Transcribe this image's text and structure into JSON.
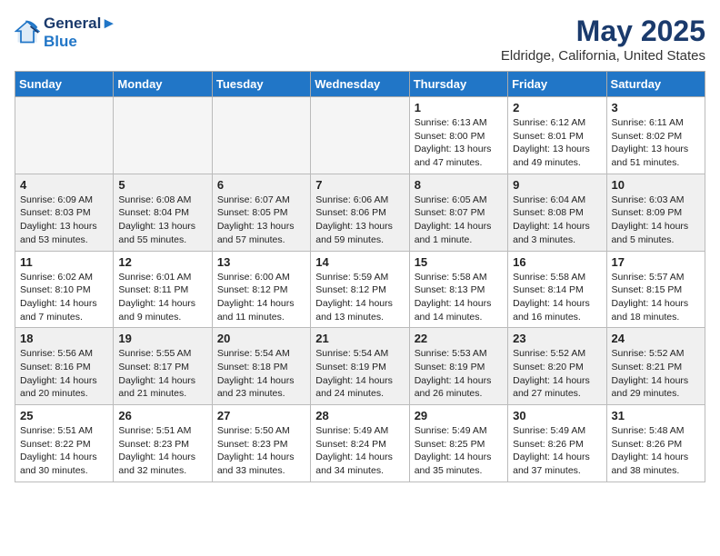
{
  "logo": {
    "line1": "General",
    "line2": "Blue"
  },
  "title": "May 2025",
  "location": "Eldridge, California, United States",
  "weekdays": [
    "Sunday",
    "Monday",
    "Tuesday",
    "Wednesday",
    "Thursday",
    "Friday",
    "Saturday"
  ],
  "weeks": [
    [
      {
        "day": "",
        "info": ""
      },
      {
        "day": "",
        "info": ""
      },
      {
        "day": "",
        "info": ""
      },
      {
        "day": "",
        "info": ""
      },
      {
        "day": "1",
        "info": "Sunrise: 6:13 AM\nSunset: 8:00 PM\nDaylight: 13 hours\nand 47 minutes."
      },
      {
        "day": "2",
        "info": "Sunrise: 6:12 AM\nSunset: 8:01 PM\nDaylight: 13 hours\nand 49 minutes."
      },
      {
        "day": "3",
        "info": "Sunrise: 6:11 AM\nSunset: 8:02 PM\nDaylight: 13 hours\nand 51 minutes."
      }
    ],
    [
      {
        "day": "4",
        "info": "Sunrise: 6:09 AM\nSunset: 8:03 PM\nDaylight: 13 hours\nand 53 minutes."
      },
      {
        "day": "5",
        "info": "Sunrise: 6:08 AM\nSunset: 8:04 PM\nDaylight: 13 hours\nand 55 minutes."
      },
      {
        "day": "6",
        "info": "Sunrise: 6:07 AM\nSunset: 8:05 PM\nDaylight: 13 hours\nand 57 minutes."
      },
      {
        "day": "7",
        "info": "Sunrise: 6:06 AM\nSunset: 8:06 PM\nDaylight: 13 hours\nand 59 minutes."
      },
      {
        "day": "8",
        "info": "Sunrise: 6:05 AM\nSunset: 8:07 PM\nDaylight: 14 hours\nand 1 minute."
      },
      {
        "day": "9",
        "info": "Sunrise: 6:04 AM\nSunset: 8:08 PM\nDaylight: 14 hours\nand 3 minutes."
      },
      {
        "day": "10",
        "info": "Sunrise: 6:03 AM\nSunset: 8:09 PM\nDaylight: 14 hours\nand 5 minutes."
      }
    ],
    [
      {
        "day": "11",
        "info": "Sunrise: 6:02 AM\nSunset: 8:10 PM\nDaylight: 14 hours\nand 7 minutes."
      },
      {
        "day": "12",
        "info": "Sunrise: 6:01 AM\nSunset: 8:11 PM\nDaylight: 14 hours\nand 9 minutes."
      },
      {
        "day": "13",
        "info": "Sunrise: 6:00 AM\nSunset: 8:12 PM\nDaylight: 14 hours\nand 11 minutes."
      },
      {
        "day": "14",
        "info": "Sunrise: 5:59 AM\nSunset: 8:12 PM\nDaylight: 14 hours\nand 13 minutes."
      },
      {
        "day": "15",
        "info": "Sunrise: 5:58 AM\nSunset: 8:13 PM\nDaylight: 14 hours\nand 14 minutes."
      },
      {
        "day": "16",
        "info": "Sunrise: 5:58 AM\nSunset: 8:14 PM\nDaylight: 14 hours\nand 16 minutes."
      },
      {
        "day": "17",
        "info": "Sunrise: 5:57 AM\nSunset: 8:15 PM\nDaylight: 14 hours\nand 18 minutes."
      }
    ],
    [
      {
        "day": "18",
        "info": "Sunrise: 5:56 AM\nSunset: 8:16 PM\nDaylight: 14 hours\nand 20 minutes."
      },
      {
        "day": "19",
        "info": "Sunrise: 5:55 AM\nSunset: 8:17 PM\nDaylight: 14 hours\nand 21 minutes."
      },
      {
        "day": "20",
        "info": "Sunrise: 5:54 AM\nSunset: 8:18 PM\nDaylight: 14 hours\nand 23 minutes."
      },
      {
        "day": "21",
        "info": "Sunrise: 5:54 AM\nSunset: 8:19 PM\nDaylight: 14 hours\nand 24 minutes."
      },
      {
        "day": "22",
        "info": "Sunrise: 5:53 AM\nSunset: 8:19 PM\nDaylight: 14 hours\nand 26 minutes."
      },
      {
        "day": "23",
        "info": "Sunrise: 5:52 AM\nSunset: 8:20 PM\nDaylight: 14 hours\nand 27 minutes."
      },
      {
        "day": "24",
        "info": "Sunrise: 5:52 AM\nSunset: 8:21 PM\nDaylight: 14 hours\nand 29 minutes."
      }
    ],
    [
      {
        "day": "25",
        "info": "Sunrise: 5:51 AM\nSunset: 8:22 PM\nDaylight: 14 hours\nand 30 minutes."
      },
      {
        "day": "26",
        "info": "Sunrise: 5:51 AM\nSunset: 8:23 PM\nDaylight: 14 hours\nand 32 minutes."
      },
      {
        "day": "27",
        "info": "Sunrise: 5:50 AM\nSunset: 8:23 PM\nDaylight: 14 hours\nand 33 minutes."
      },
      {
        "day": "28",
        "info": "Sunrise: 5:49 AM\nSunset: 8:24 PM\nDaylight: 14 hours\nand 34 minutes."
      },
      {
        "day": "29",
        "info": "Sunrise: 5:49 AM\nSunset: 8:25 PM\nDaylight: 14 hours\nand 35 minutes."
      },
      {
        "day": "30",
        "info": "Sunrise: 5:49 AM\nSunset: 8:26 PM\nDaylight: 14 hours\nand 37 minutes."
      },
      {
        "day": "31",
        "info": "Sunrise: 5:48 AM\nSunset: 8:26 PM\nDaylight: 14 hours\nand 38 minutes."
      }
    ]
  ]
}
